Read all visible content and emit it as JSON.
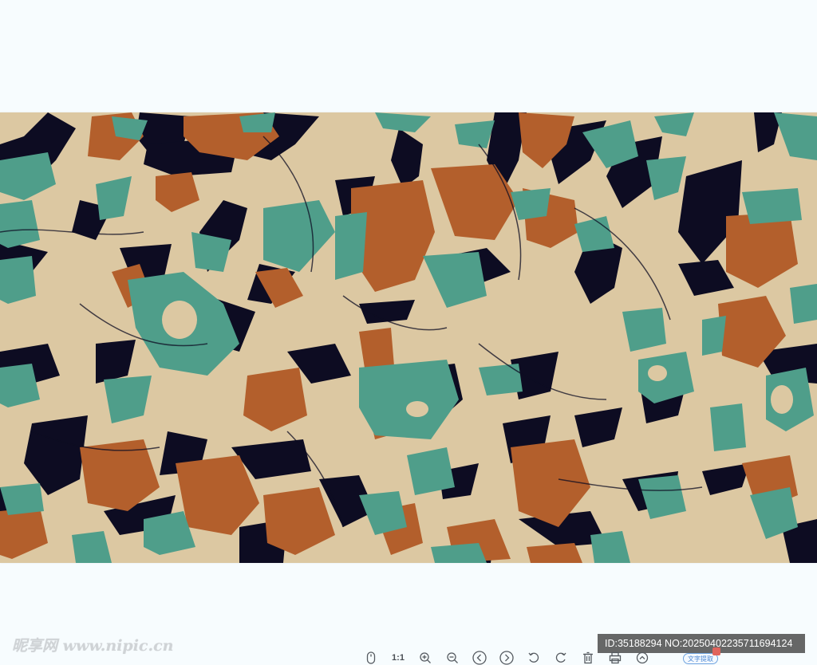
{
  "viewer": {
    "background": "#f7fcfe"
  },
  "image": {
    "palette": {
      "beige": "#dcc8a2",
      "teal": "#4f9e8a",
      "rust": "#b35f2c",
      "navy": "#0d0c22"
    }
  },
  "watermark": {
    "text": "昵享网 www.nipic.cn"
  },
  "id_badge": {
    "text": "ID:35188294 NO:20250402235711694124"
  },
  "toolbar": {
    "items": [
      {
        "name": "mouse-icon"
      },
      {
        "name": "actual-size",
        "label": "1:1"
      },
      {
        "name": "zoom-in-icon"
      },
      {
        "name": "zoom-out-icon"
      },
      {
        "name": "previous-icon"
      },
      {
        "name": "next-icon"
      },
      {
        "name": "rotate-left-icon"
      },
      {
        "name": "rotate-right-icon"
      },
      {
        "name": "delete-icon"
      },
      {
        "name": "print-icon"
      },
      {
        "name": "collapse-icon"
      }
    ],
    "text_extract_label": "文字提取"
  }
}
